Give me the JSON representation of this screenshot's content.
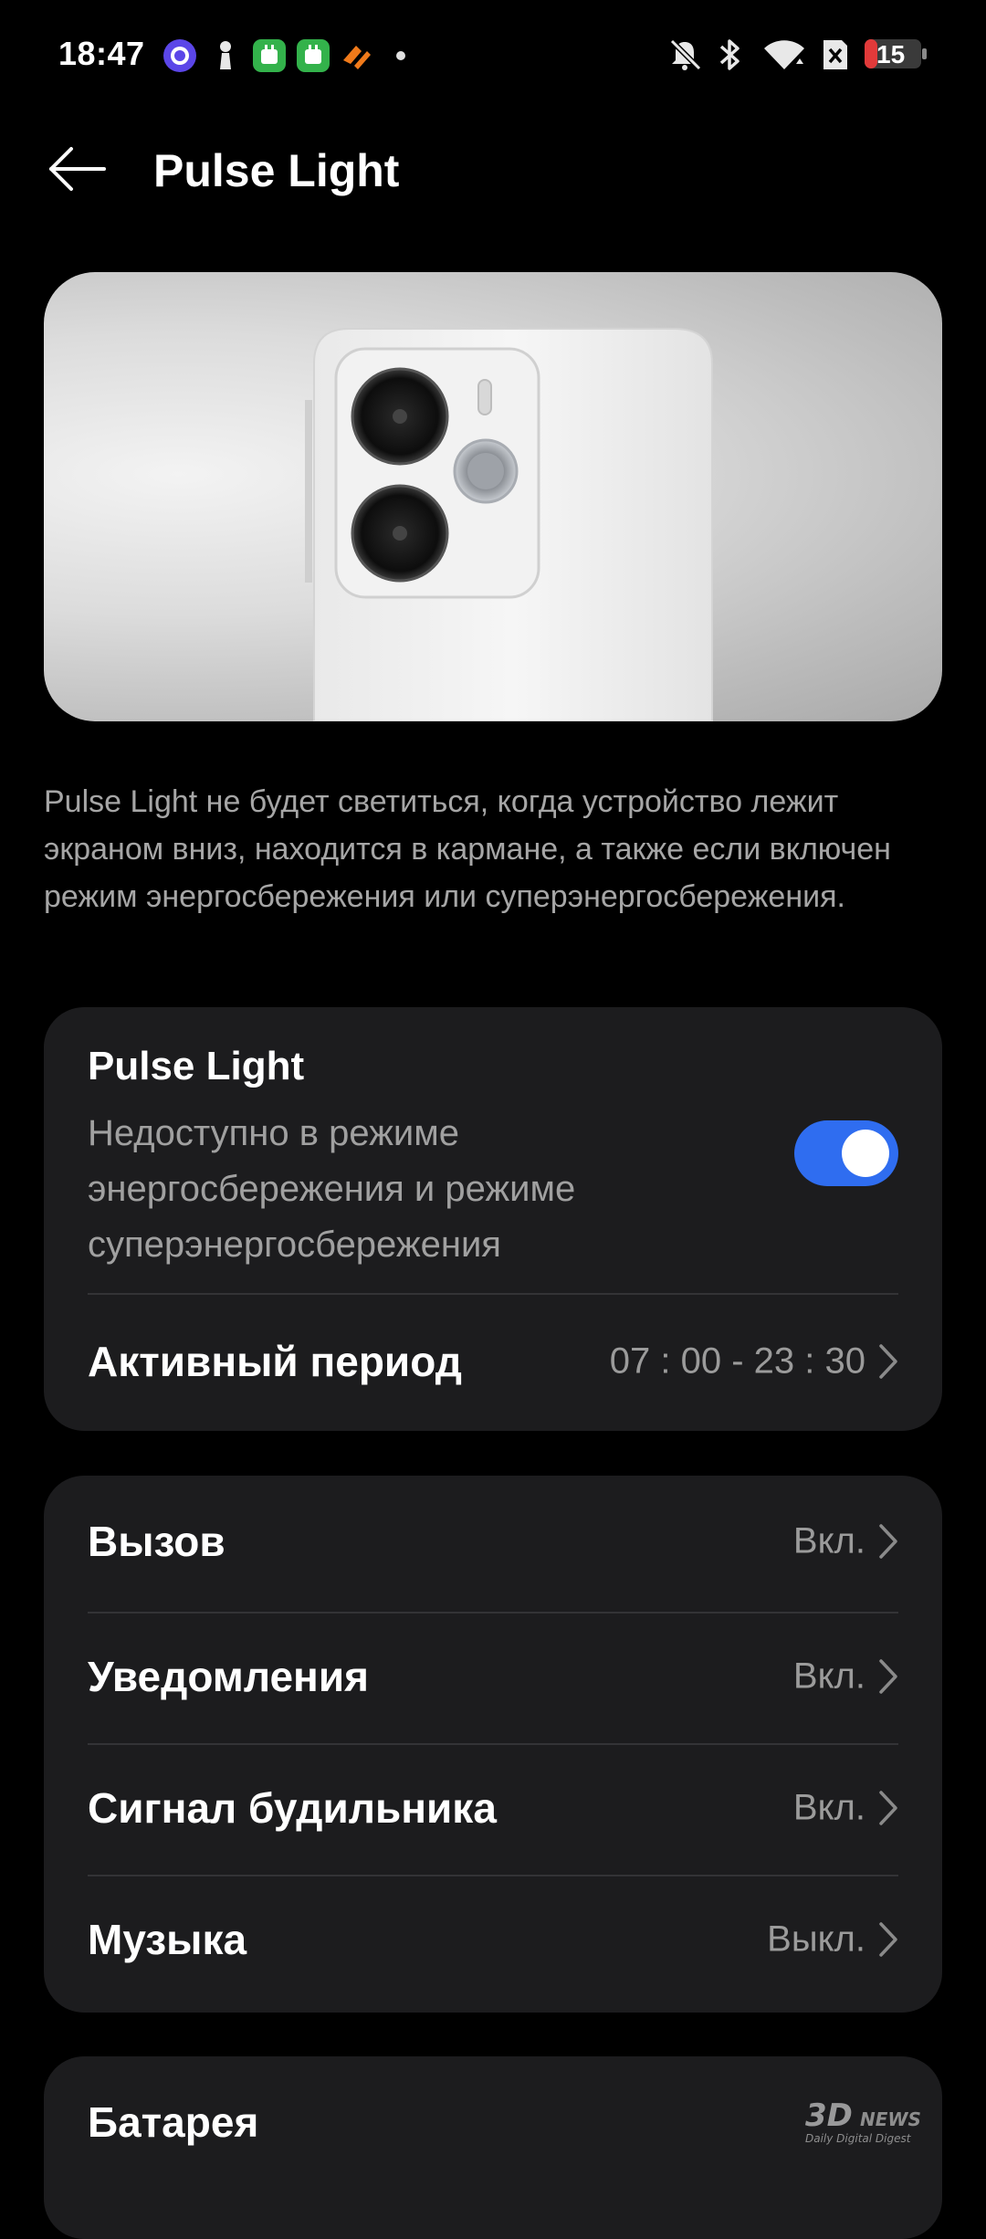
{
  "status_bar": {
    "time": "18:47",
    "battery": "15"
  },
  "header": {
    "title": "Pulse Light"
  },
  "description": "Pulse Light не будет светиться, когда устройство лежит экраном вниз, находится в кармане, а также если включен режим энергосбережения или суперэнергосбережения.",
  "pulse_card": {
    "title": "Pulse Light",
    "subtitle": "Недоступно в режиме энергосбережения и режиме суперэнергосбережения",
    "enabled": true,
    "active_period": {
      "label": "Активный период",
      "value": "07 : 00 - 23 : 30"
    }
  },
  "events": [
    {
      "label": "Вызов",
      "value": "Вкл."
    },
    {
      "label": "Уведомления",
      "value": "Вкл."
    },
    {
      "label": "Сигнал будильника",
      "value": "Вкл."
    },
    {
      "label": "Музыка",
      "value": "Выкл."
    }
  ],
  "battery_row": {
    "label": "Батарея"
  },
  "colors": {
    "accent": "#2f6df0",
    "card": "#1c1c1e",
    "background": "#000000"
  }
}
